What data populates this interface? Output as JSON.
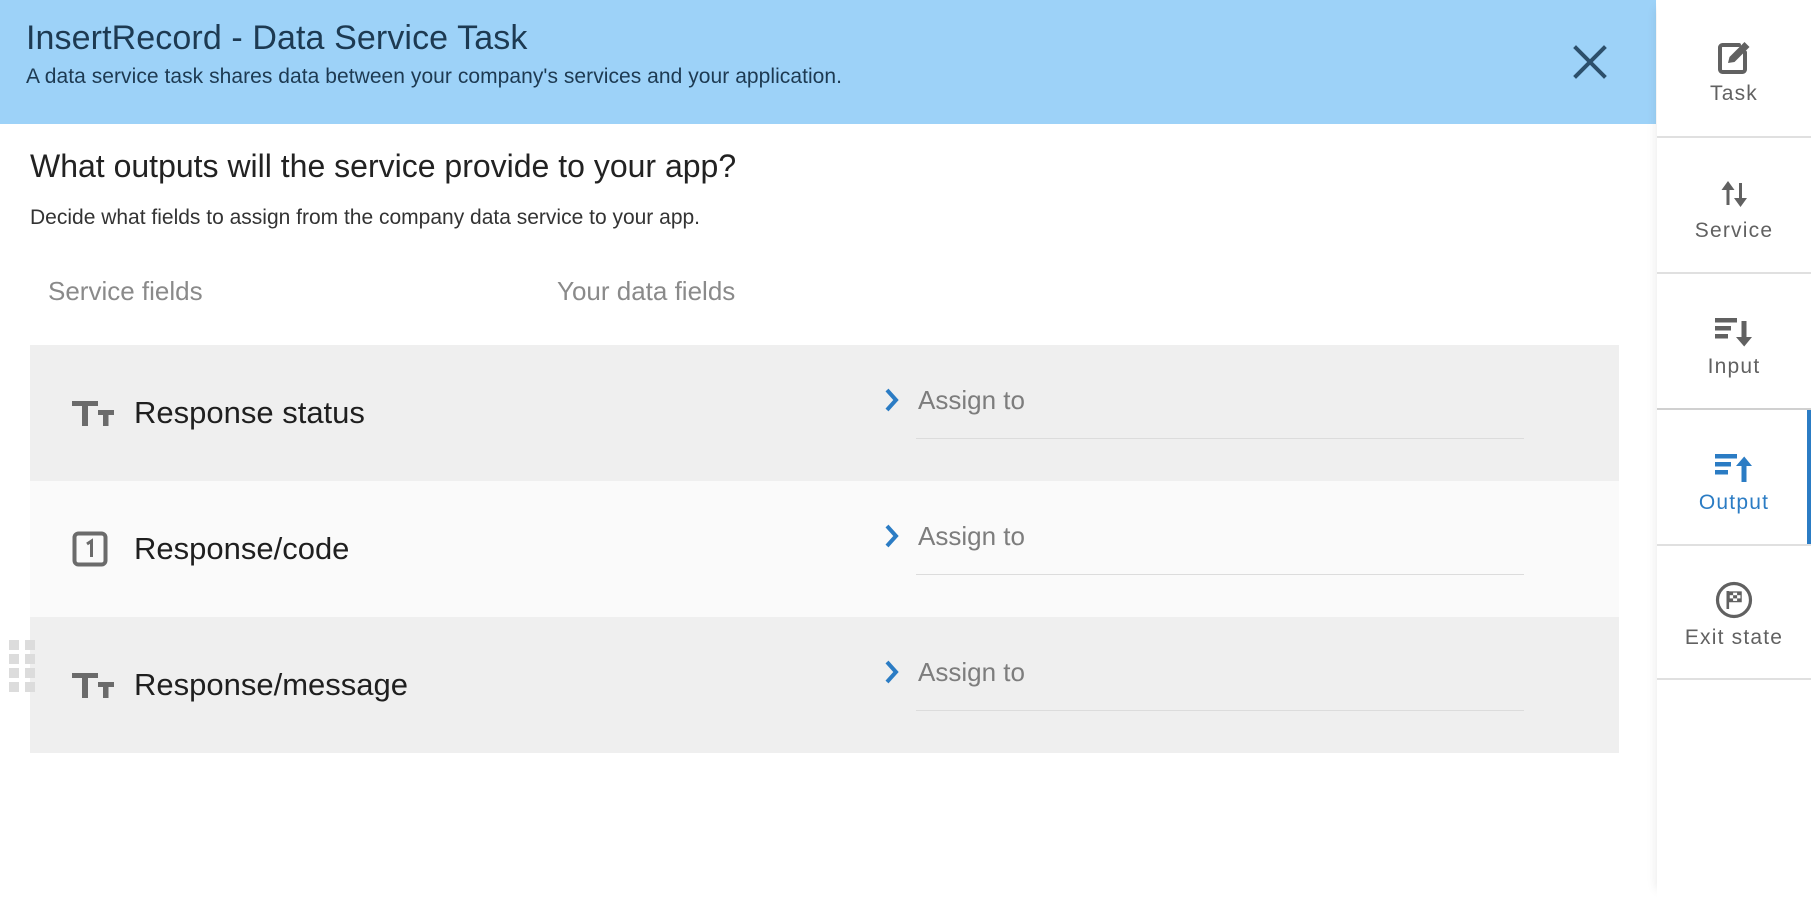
{
  "dialog": {
    "title": "InsertRecord - Data Service Task",
    "subtitle": "A data service task shares data between your company's services and your application.",
    "close_icon": "close-icon",
    "question": "What outputs will the service provide to your app?",
    "description": "Decide what fields to assign from the company data service to your app.",
    "columns": {
      "service_fields": "Service fields",
      "your_data_fields": "Your data fields"
    },
    "rows": [
      {
        "icon": "text-type-icon",
        "icon_glyph": "Tт",
        "name": "Response status",
        "assign_chevron_icon": "chevron-right-icon",
        "assign_placeholder": "Assign to",
        "assign_value": ""
      },
      {
        "icon": "number-type-icon",
        "icon_glyph": "1",
        "name": "Response/code",
        "assign_chevron_icon": "chevron-right-icon",
        "assign_placeholder": "Assign to",
        "assign_value": ""
      },
      {
        "icon": "text-type-icon",
        "icon_glyph": "Tт",
        "name": "Response/message",
        "assign_chevron_icon": "chevron-right-icon",
        "assign_placeholder": "Assign to",
        "assign_value": ""
      }
    ],
    "drag_handle_icon": "drag-handle-icon"
  },
  "sidebar": {
    "items": [
      {
        "label": "Task",
        "icon": "pencil-square-icon",
        "active": false
      },
      {
        "label": "Service",
        "icon": "up-down-arrows-icon",
        "active": false
      },
      {
        "label": "Input",
        "icon": "list-arrow-down-icon",
        "active": false
      },
      {
        "label": "Output",
        "icon": "list-arrow-up-icon",
        "active": true
      },
      {
        "label": "Exit state",
        "icon": "checkered-flag-circle-icon",
        "active": false
      }
    ]
  },
  "colors": {
    "header_blue": "#9dd2f8",
    "header_text": "#1d3a52",
    "accent_blue": "#2b7cc4",
    "row_odd": "#efefef",
    "row_even": "#fafafa",
    "muted_text": "#8a8a8a"
  }
}
